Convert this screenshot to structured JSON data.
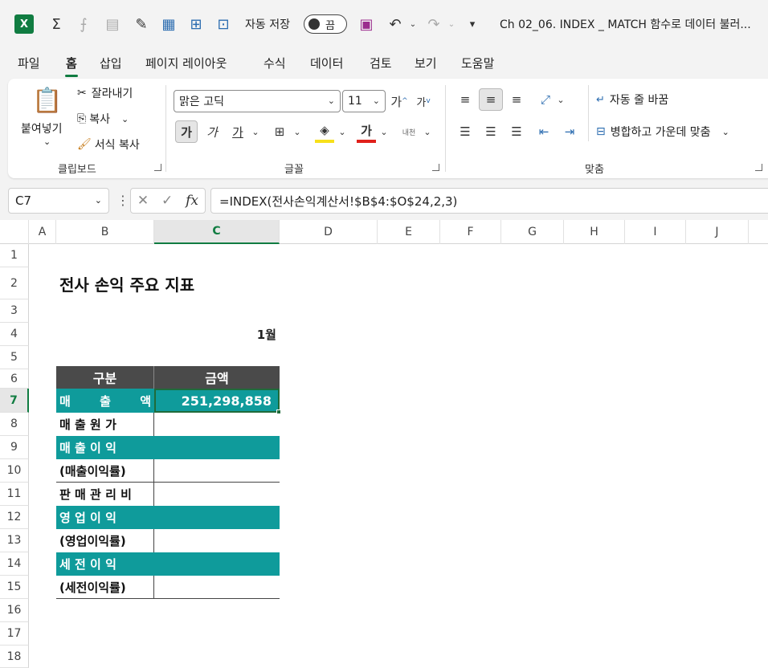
{
  "titlebar": {
    "app_logo": "X",
    "autosave_label": "자동 저장",
    "autosave_state": "끔",
    "doc_title": "Ch 02_06. INDEX _ MATCH 함수로 데이터 불러..."
  },
  "tabs": [
    {
      "label": "파일"
    },
    {
      "label": "홈"
    },
    {
      "label": "삽입"
    },
    {
      "label": "페이지 레이아웃"
    },
    {
      "label": "수식"
    },
    {
      "label": "데이터"
    },
    {
      "label": "검토"
    },
    {
      "label": "보기"
    },
    {
      "label": "도움말"
    }
  ],
  "ribbon": {
    "clipboard": {
      "paste": "붙여넣기",
      "cut": "잘라내기",
      "copy": "복사",
      "format_painter": "서식 복사",
      "group": "클립보드"
    },
    "font": {
      "family": "맑은 고딕",
      "size": "11",
      "bold": "가",
      "italic": "가",
      "underline": "가",
      "font_color": "가",
      "phonetic": "내천",
      "grow": "가",
      "shrink": "가",
      "group": "글꼴"
    },
    "alignment": {
      "wrap": "자동 줄 바꿈",
      "merge": "병합하고 가운데 맞춤",
      "group": "맞춤"
    }
  },
  "formula_bar": {
    "name_box": "C7",
    "fx": "fx",
    "formula": "=INDEX(전사손익계산서!$B$4:$O$24,2,3)"
  },
  "columns": [
    "A",
    "B",
    "C",
    "D",
    "E",
    "F",
    "G",
    "H",
    "I",
    "J"
  ],
  "rows": [
    "1",
    "2",
    "3",
    "4",
    "5",
    "6",
    "7",
    "8",
    "9",
    "10",
    "11",
    "12",
    "13",
    "14",
    "15",
    "16",
    "17",
    "18"
  ],
  "sheet": {
    "title": "전사 손익 주요 지표",
    "month": "1월",
    "header_category": "구분",
    "header_amount": "금액",
    "items": [
      {
        "label": "매 출 액",
        "value": "251,298,858"
      },
      {
        "label": "매 출 원 가",
        "value": ""
      },
      {
        "label": "매 출 이 익",
        "value": ""
      },
      {
        "label": "(매출이익률)",
        "value": ""
      },
      {
        "label": "판 매 관 리 비",
        "value": ""
      },
      {
        "label": "영 업 이 익",
        "value": ""
      },
      {
        "label": "(영업이익률)",
        "value": ""
      },
      {
        "label": "세 전 이 익",
        "value": ""
      },
      {
        "label": "(세전이익률)",
        "value": ""
      }
    ]
  },
  "colors": {
    "accent": "#107c41",
    "teal": "#0f9b9b",
    "header_fill": "#4a4a4a"
  }
}
